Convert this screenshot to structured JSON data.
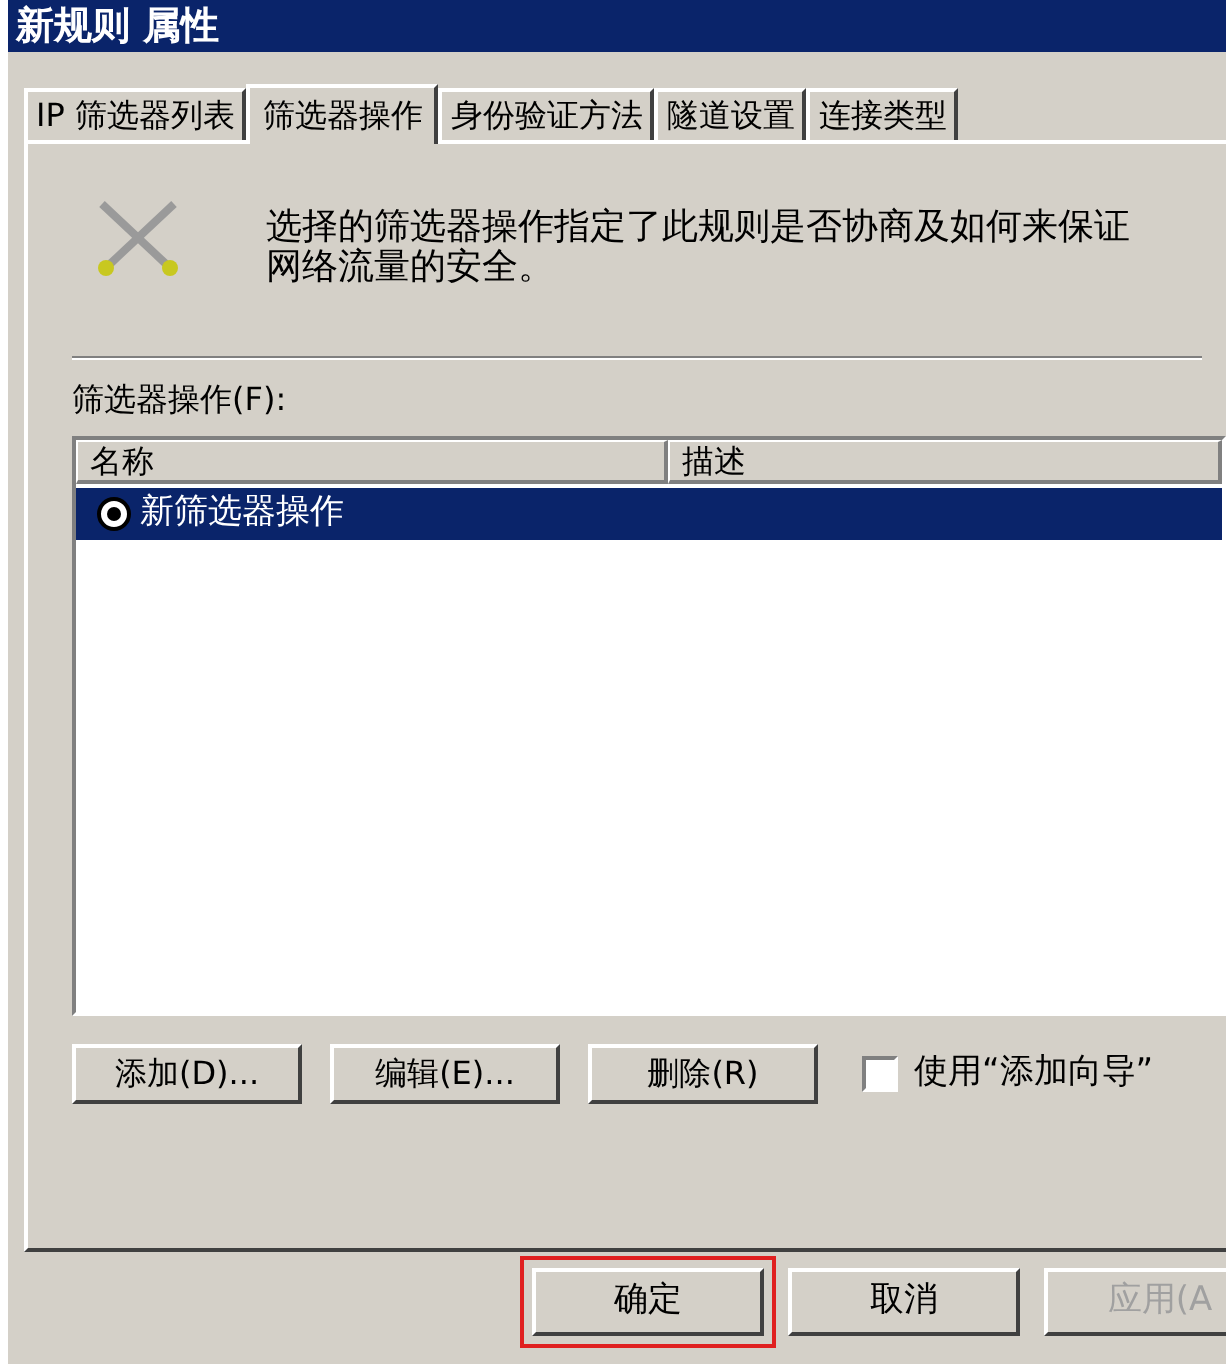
{
  "window": {
    "title": "新规则 属性"
  },
  "tabs": [
    {
      "label": "IP 筛选器列表",
      "selected": false
    },
    {
      "label": "筛选器操作",
      "selected": true
    },
    {
      "label": "身份验证方法",
      "selected": false
    },
    {
      "label": "隧道设置",
      "selected": false
    },
    {
      "label": "连接类型",
      "selected": false
    }
  ],
  "description": "选择的筛选器操作指定了此规则是否协商及如何来保证网络流量的安全。",
  "list_label": "筛选器操作(F):",
  "list": {
    "columns": [
      "名称",
      "描述"
    ],
    "rows": [
      {
        "name": "新筛选器操作",
        "radio_checked": true,
        "selected": true
      }
    ]
  },
  "list_buttons": [
    "添加(D)...",
    "编辑(E)...",
    "删除(R)"
  ],
  "wizard_checkbox": {
    "label": "使用“添加向导”",
    "checked": false
  },
  "dialog_buttons": [
    {
      "label": "确定",
      "disabled": false,
      "highlighted": true
    },
    {
      "label": "取消",
      "disabled": false,
      "highlighted": false
    },
    {
      "label": "应用(A",
      "disabled": true,
      "highlighted": false
    }
  ]
}
